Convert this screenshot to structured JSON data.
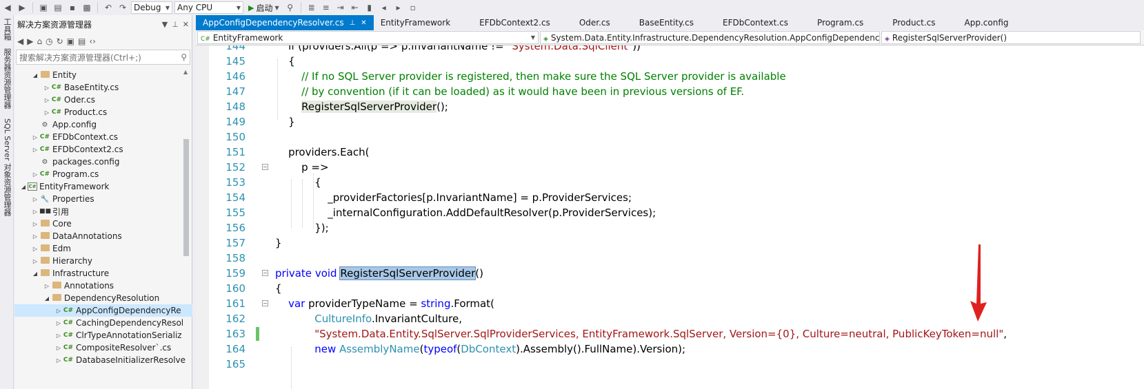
{
  "toolbar": {
    "config": "Debug",
    "platform": "Any CPU",
    "start": "启动"
  },
  "side_strip": {
    "labels": [
      "工具箱",
      "服务器资源管理器",
      "SQL Server 对象资源管理器"
    ]
  },
  "solution_explorer": {
    "title": "解决方案资源管理器",
    "search_placeholder": "搜索解决方案资源管理器(Ctrl+;)",
    "items": [
      {
        "label": "Entity",
        "icon": "folder",
        "indent": 2,
        "exp": "◢"
      },
      {
        "label": "BaseEntity.cs",
        "icon": "cs",
        "indent": 3,
        "exp": "▷"
      },
      {
        "label": "Oder.cs",
        "icon": "cs",
        "indent": 3,
        "exp": "▷"
      },
      {
        "label": "Product.cs",
        "icon": "cs",
        "indent": 3,
        "exp": "▷"
      },
      {
        "label": "App.config",
        "icon": "cfg",
        "indent": 2,
        "exp": ""
      },
      {
        "label": "EFDbContext.cs",
        "icon": "cs",
        "indent": 2,
        "exp": "▷"
      },
      {
        "label": "EFDbContext2.cs",
        "icon": "cs",
        "indent": 2,
        "exp": "▷"
      },
      {
        "label": "packages.config",
        "icon": "cfg",
        "indent": 2,
        "exp": ""
      },
      {
        "label": "Program.cs",
        "icon": "cs",
        "indent": 2,
        "exp": "▷"
      },
      {
        "label": "EntityFramework",
        "icon": "proj",
        "indent": 1,
        "exp": "◢"
      },
      {
        "label": "Properties",
        "icon": "prop",
        "indent": 2,
        "exp": "▷"
      },
      {
        "label": "引用",
        "icon": "ref",
        "indent": 2,
        "exp": "▷"
      },
      {
        "label": "Core",
        "icon": "folder",
        "indent": 2,
        "exp": "▷"
      },
      {
        "label": "DataAnnotations",
        "icon": "folder",
        "indent": 2,
        "exp": "▷"
      },
      {
        "label": "Edm",
        "icon": "folder",
        "indent": 2,
        "exp": "▷"
      },
      {
        "label": "Hierarchy",
        "icon": "folder",
        "indent": 2,
        "exp": "▷"
      },
      {
        "label": "Infrastructure",
        "icon": "folder",
        "indent": 2,
        "exp": "◢"
      },
      {
        "label": "Annotations",
        "icon": "folder",
        "indent": 3,
        "exp": "▷"
      },
      {
        "label": "DependencyResolution",
        "icon": "folder",
        "indent": 3,
        "exp": "◢"
      },
      {
        "label": "AppConfigDependencyRe",
        "icon": "cs",
        "indent": 4,
        "exp": "▷",
        "selected": true
      },
      {
        "label": "CachingDependencyResol",
        "icon": "cs",
        "indent": 4,
        "exp": "▷"
      },
      {
        "label": "ClrTypeAnnotationSerializ",
        "icon": "cs",
        "indent": 4,
        "exp": "▷"
      },
      {
        "label": "CompositeResolver`.cs",
        "icon": "cs",
        "indent": 4,
        "exp": "▷"
      },
      {
        "label": "DatabaseInitializerResolve",
        "icon": "cs",
        "indent": 4,
        "exp": "▷"
      }
    ]
  },
  "tabs": [
    {
      "label": "AppConfigDependencyResolver.cs",
      "active": true
    },
    {
      "label": "EntityFramework"
    },
    {
      "label": "EFDbContext2.cs"
    },
    {
      "label": "Oder.cs"
    },
    {
      "label": "BaseEntity.cs"
    },
    {
      "label": "EFDbContext.cs"
    },
    {
      "label": "Program.cs"
    },
    {
      "label": "Product.cs"
    },
    {
      "label": "App.config"
    }
  ],
  "navbar": {
    "project": "EntityFramework",
    "type": "System.Data.Entity.Infrastructure.DependencyResolution.AppConfigDependencyReso",
    "member": "RegisterSqlServerProvider()"
  },
  "code_lines": [
    {
      "n": "144",
      "parts": [
        [
          "p",
          "    if (providers.All(p => p.InvariantName != "
        ],
        [
          "str",
          "\"System.Data.SqlClient\""
        ],
        [
          "p",
          "))"
        ]
      ]
    },
    {
      "n": "145",
      "parts": [
        [
          "p",
          "    {"
        ]
      ]
    },
    {
      "n": "146",
      "parts": [
        [
          "cm",
          "        // If no SQL Server provider is registered, then make sure the SQL Server provider is available"
        ]
      ]
    },
    {
      "n": "147",
      "parts": [
        [
          "cm",
          "        // by convention (if it can be loaded) as it would have been in previous versions of EF."
        ]
      ]
    },
    {
      "n": "148",
      "parts": [
        [
          "p",
          "        "
        ],
        [
          "ref",
          "RegisterSqlServerProvider"
        ],
        [
          "p",
          "();"
        ]
      ]
    },
    {
      "n": "149",
      "parts": [
        [
          "p",
          "    }"
        ]
      ]
    },
    {
      "n": "150",
      "parts": [
        [
          "p",
          ""
        ]
      ]
    },
    {
      "n": "151",
      "parts": [
        [
          "p",
          "    providers.Each("
        ]
      ]
    },
    {
      "n": "152",
      "parts": [
        [
          "p",
          "        p =>"
        ]
      ],
      "fold": true
    },
    {
      "n": "153",
      "parts": [
        [
          "p",
          "            {"
        ]
      ]
    },
    {
      "n": "154",
      "parts": [
        [
          "p",
          "                _providerFactories[p.InvariantName] = p.ProviderServices;"
        ]
      ]
    },
    {
      "n": "155",
      "parts": [
        [
          "p",
          "                _internalConfiguration.AddDefaultResolver(p.ProviderServices);"
        ]
      ]
    },
    {
      "n": "156",
      "parts": [
        [
          "p",
          "            });"
        ]
      ]
    },
    {
      "n": "157",
      "parts": [
        [
          "p",
          "}"
        ]
      ]
    },
    {
      "n": "158",
      "parts": [
        [
          "p",
          ""
        ]
      ]
    },
    {
      "n": "159",
      "parts": [
        [
          "kw",
          "private"
        ],
        [
          "p",
          " "
        ],
        [
          "kw",
          "void"
        ],
        [
          "p",
          " "
        ],
        [
          "sel",
          "RegisterSqlServerProvider"
        ],
        [
          "p",
          "()"
        ]
      ],
      "fold": true
    },
    {
      "n": "160",
      "parts": [
        [
          "p",
          "{"
        ]
      ]
    },
    {
      "n": "161",
      "parts": [
        [
          "p",
          "    "
        ],
        [
          "kw",
          "var"
        ],
        [
          "p",
          " providerTypeName = "
        ],
        [
          "kw",
          "string"
        ],
        [
          "p",
          ".Format("
        ]
      ],
      "fold": true
    },
    {
      "n": "162",
      "parts": [
        [
          "p",
          "            "
        ],
        [
          "ty",
          "CultureInfo"
        ],
        [
          "p",
          ".InvariantCulture,"
        ]
      ]
    },
    {
      "n": "163",
      "parts": [
        [
          "p",
          "            "
        ],
        [
          "str",
          "\"System.Data.Entity.SqlServer.SqlProviderServices, EntityFramework.SqlServer, Version={0}, Culture=neutral, PublicKeyToken=null\""
        ],
        [
          "p",
          ","
        ]
      ],
      "changed": true
    },
    {
      "n": "164",
      "parts": [
        [
          "p",
          "            "
        ],
        [
          "kw",
          "new"
        ],
        [
          "p",
          " "
        ],
        [
          "ty",
          "AssemblyName"
        ],
        [
          "p",
          "("
        ],
        [
          "kw",
          "typeof"
        ],
        [
          "p",
          "("
        ],
        [
          "ty",
          "DbContext"
        ],
        [
          "p",
          ").Assembly().FullName).Version);"
        ]
      ]
    },
    {
      "n": "165",
      "parts": [
        [
          "p",
          ""
        ]
      ]
    }
  ],
  "colors": {
    "accent": "#007acc",
    "keyword": "#0000ff",
    "type": "#2b91af",
    "comment": "#008000",
    "string": "#a31515",
    "arrow": "#e02020"
  }
}
